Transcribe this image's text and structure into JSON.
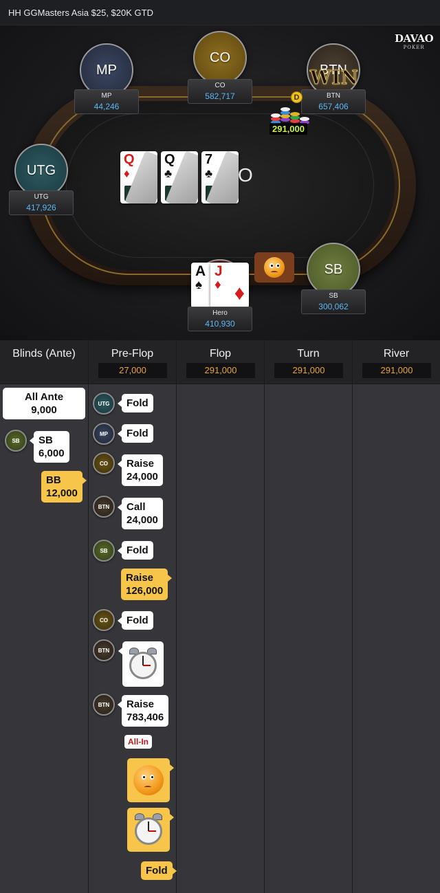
{
  "header": {
    "title": "HH  GGMasters Asia $25, $20K GTD"
  },
  "logo": {
    "main": "DAVAO",
    "sub": "POKER"
  },
  "table": {
    "seats": {
      "mp": {
        "avatar": "MP",
        "name": "MP",
        "stack": "44,246"
      },
      "co": {
        "avatar": "CO",
        "name": "CO",
        "stack": "582,717"
      },
      "btn": {
        "avatar": "BTN",
        "name": "BTN",
        "stack": "657,406",
        "win": "WIN",
        "dealer": "D"
      },
      "utg": {
        "avatar": "UTG",
        "name": "UTG",
        "stack": "417,926"
      },
      "sb": {
        "avatar": "SB",
        "name": "SB",
        "stack": "300,062"
      },
      "hero": {
        "name": "Hero",
        "stack": "410,930"
      }
    },
    "pot": "291,000",
    "board": [
      {
        "rank": "Q",
        "suit": "♦",
        "color": "#d71a1a"
      },
      {
        "rank": "Q",
        "suit": "♣",
        "color": "#111111"
      },
      {
        "rank": "7",
        "suit": "♣",
        "color": "#111111"
      }
    ],
    "board_partial_text": "O",
    "hero_cards": [
      {
        "rank": "A",
        "suit": "♠",
        "color": "#111111"
      },
      {
        "rank": "J",
        "suit": "♦",
        "color": "#d71a1a"
      }
    ]
  },
  "history": {
    "columns": [
      {
        "title": "Blinds (Ante)",
        "pot": ""
      },
      {
        "title": "Pre-Flop",
        "pot": "27,000"
      },
      {
        "title": "Flop",
        "pot": "291,000"
      },
      {
        "title": "Turn",
        "pot": "291,000"
      },
      {
        "title": "River",
        "pot": "291,000"
      }
    ],
    "blinds": {
      "ante_label": "All Ante",
      "ante_value": "9,000",
      "sb_pos": "SB",
      "sb_label": "SB",
      "sb_value": "6,000",
      "bb_label": "BB",
      "bb_value": "12,000"
    },
    "preflop": [
      {
        "pos": "UTG",
        "line1": "Fold",
        "line2": ""
      },
      {
        "pos": "MP",
        "line1": "Fold",
        "line2": ""
      },
      {
        "pos": "CO",
        "line1": "Raise",
        "line2": "24,000"
      },
      {
        "pos": "BTN",
        "line1": "Call",
        "line2": "24,000"
      },
      {
        "pos": "SB",
        "line1": "Fold",
        "line2": ""
      },
      {
        "hero": true,
        "line1": "Raise",
        "line2": "126,000"
      },
      {
        "pos": "CO",
        "line1": "Fold",
        "line2": ""
      },
      {
        "pos": "BTN",
        "emote": "clock-icon"
      },
      {
        "pos": "BTN",
        "line1": "Raise",
        "line2": "783,406",
        "badge": "All-In"
      },
      {
        "hero": true,
        "emote": "thinking-face-icon"
      },
      {
        "hero": true,
        "emote": "clock-icon"
      },
      {
        "hero": true,
        "line1": "Fold",
        "line2": ""
      }
    ]
  }
}
